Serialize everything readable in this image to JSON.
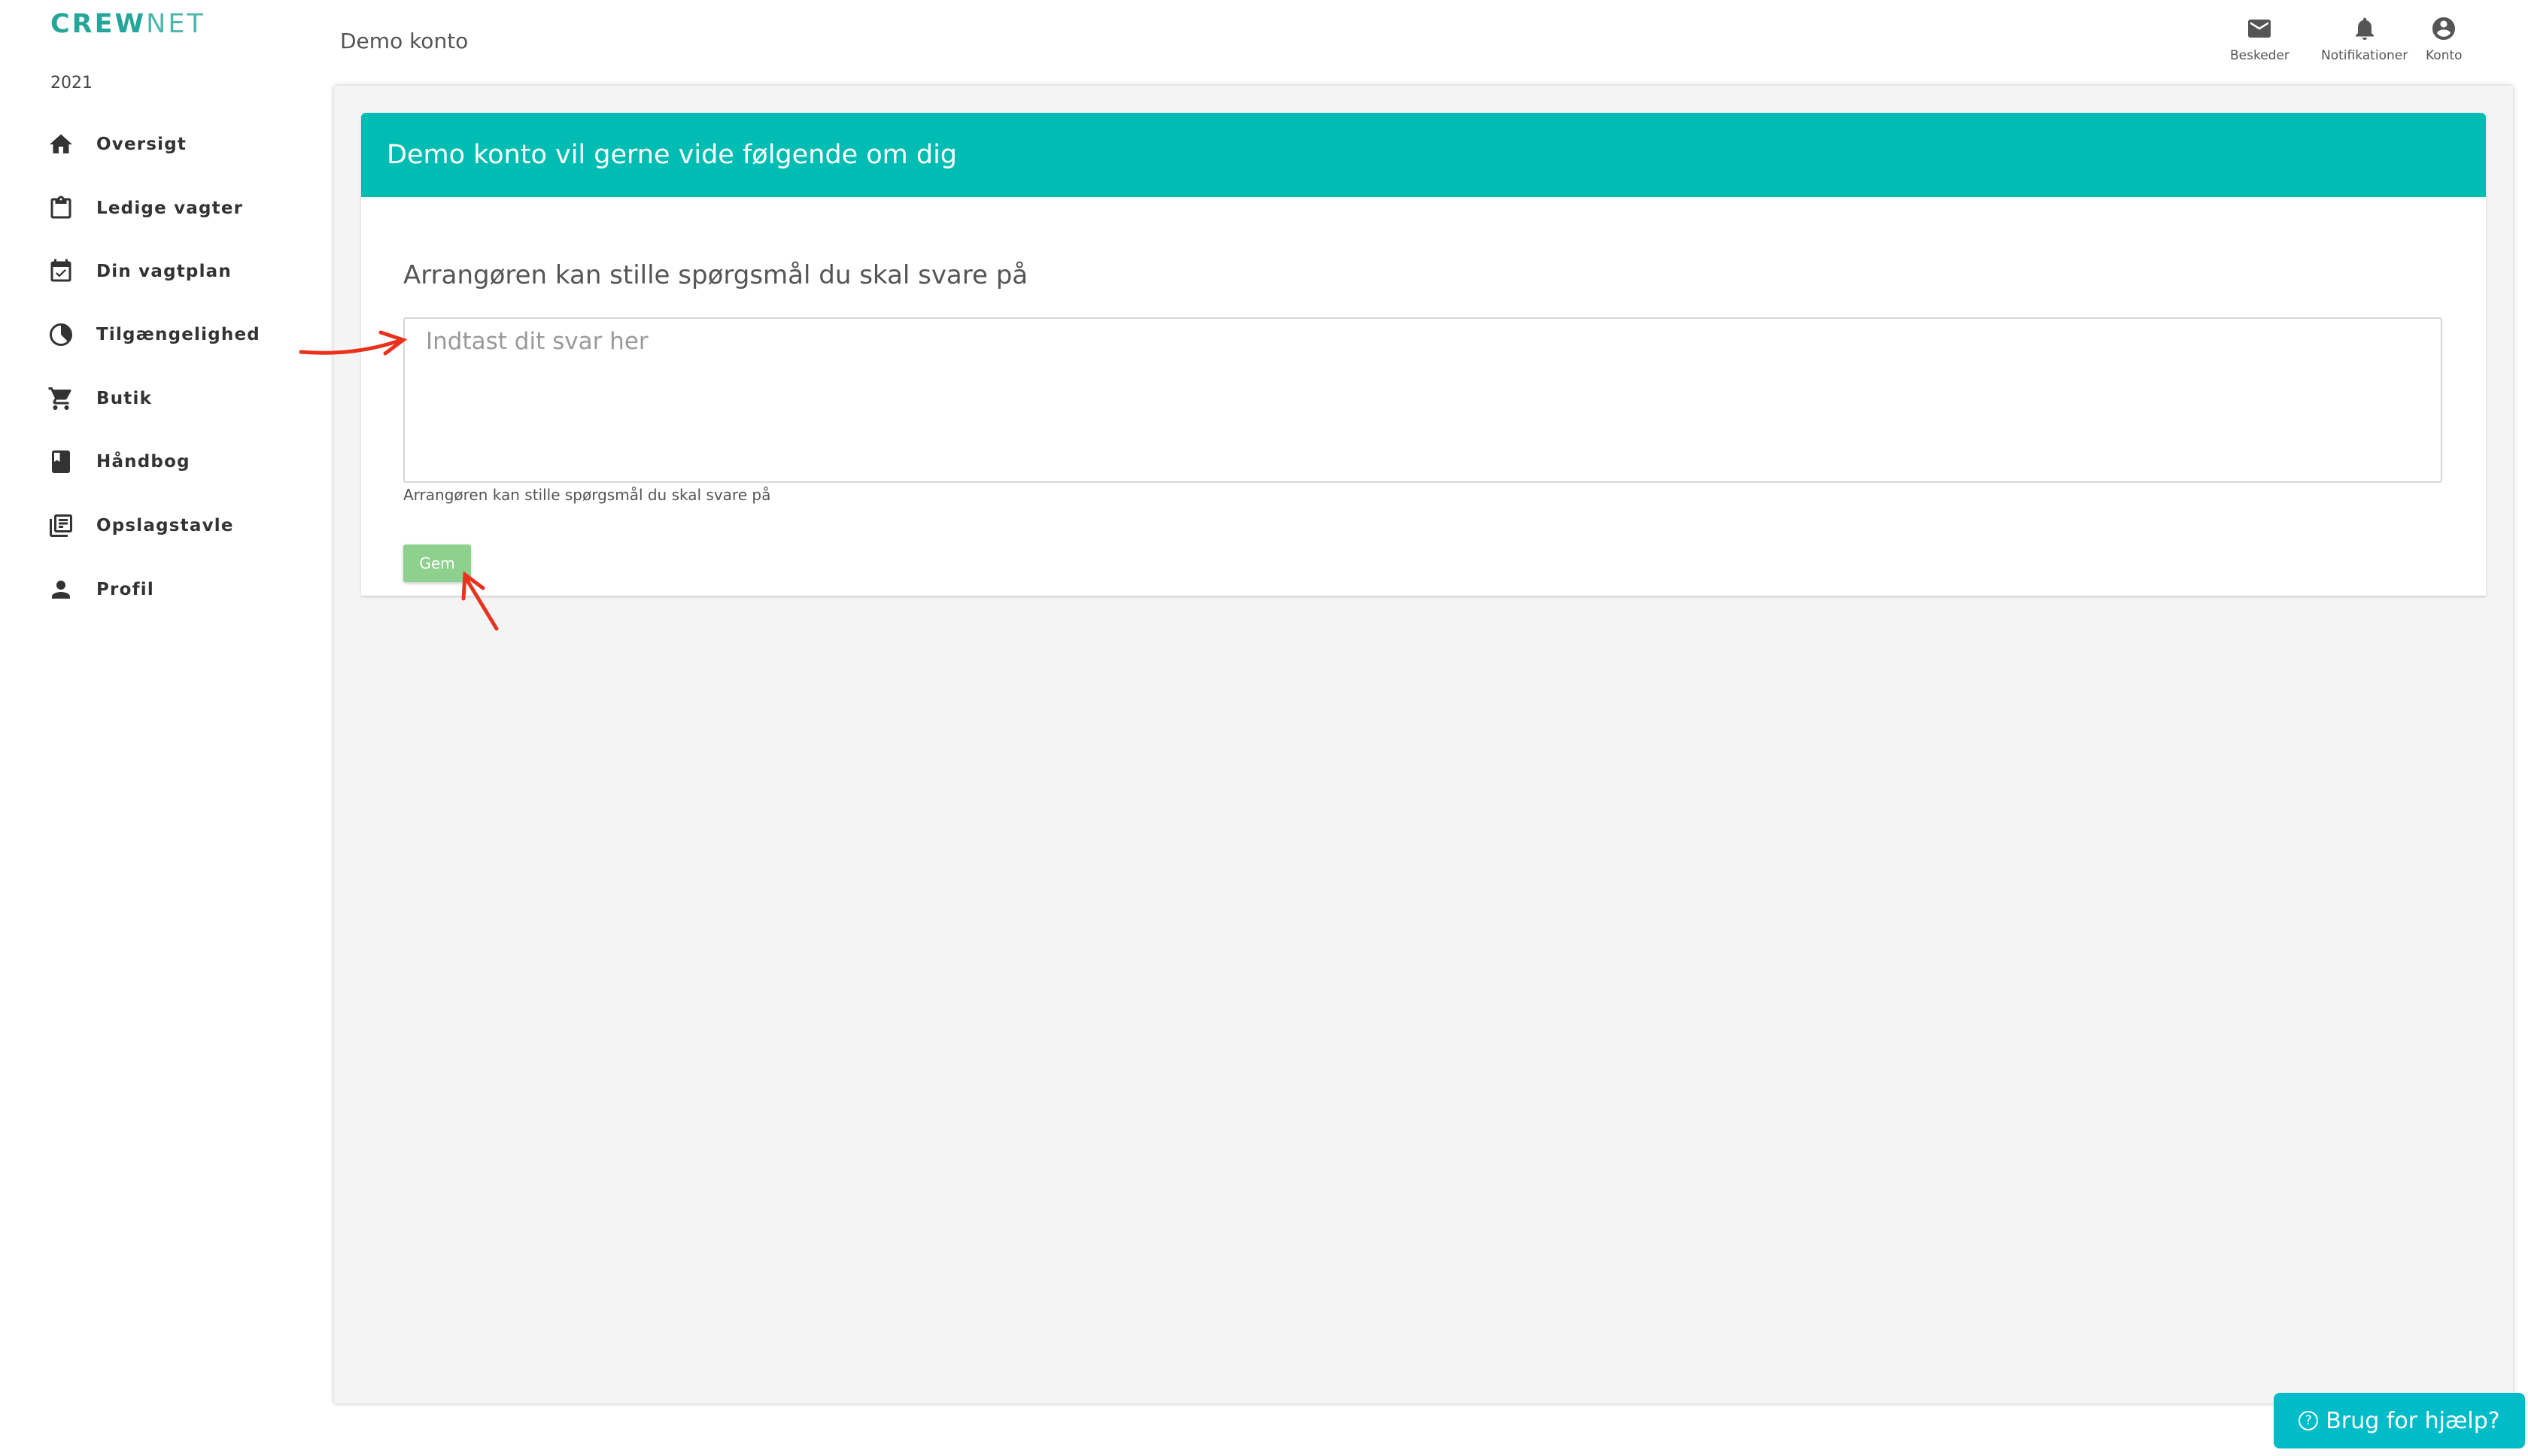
{
  "brand": {
    "bold": "CREW",
    "light": "NET"
  },
  "year": "2021",
  "sidebar": {
    "items": [
      {
        "label": "Oversigt",
        "icon": "home-icon"
      },
      {
        "label": "Ledige vagter",
        "icon": "clipboard-icon"
      },
      {
        "label": "Din vagtplan",
        "icon": "calendar-check-icon"
      },
      {
        "label": "Tilgængelighed",
        "icon": "contrast-icon"
      },
      {
        "label": "Butik",
        "icon": "cart-icon"
      },
      {
        "label": "Håndbog",
        "icon": "book-icon"
      },
      {
        "label": "Opslagstavle",
        "icon": "library-books-icon"
      },
      {
        "label": "Profil",
        "icon": "person-icon"
      }
    ]
  },
  "header": {
    "breadcrumb": "Demo konto",
    "actions": [
      {
        "label": "Beskeder",
        "icon": "mail-icon"
      },
      {
        "label": "Notifikationer",
        "icon": "bell-icon"
      },
      {
        "label": "Konto",
        "icon": "account-circle-icon"
      }
    ]
  },
  "card": {
    "title": "Demo konto vil gerne vide følgende om dig",
    "question": "Arrangøren kan stille spørgsmål du skal svare på",
    "answer_value": "",
    "answer_placeholder": "Indtast dit svar her",
    "helper": "Arrangøren kan stille spørgsmål du skal svare på",
    "save_label": "Gem"
  },
  "help": {
    "label": "Brug for hjælp?"
  },
  "colors": {
    "brand": "#26a69a",
    "header_teal": "#00bdb4",
    "save_green": "#8ed08e",
    "help_cyan": "#00bcc8",
    "annotation_red": "#e8321e"
  }
}
